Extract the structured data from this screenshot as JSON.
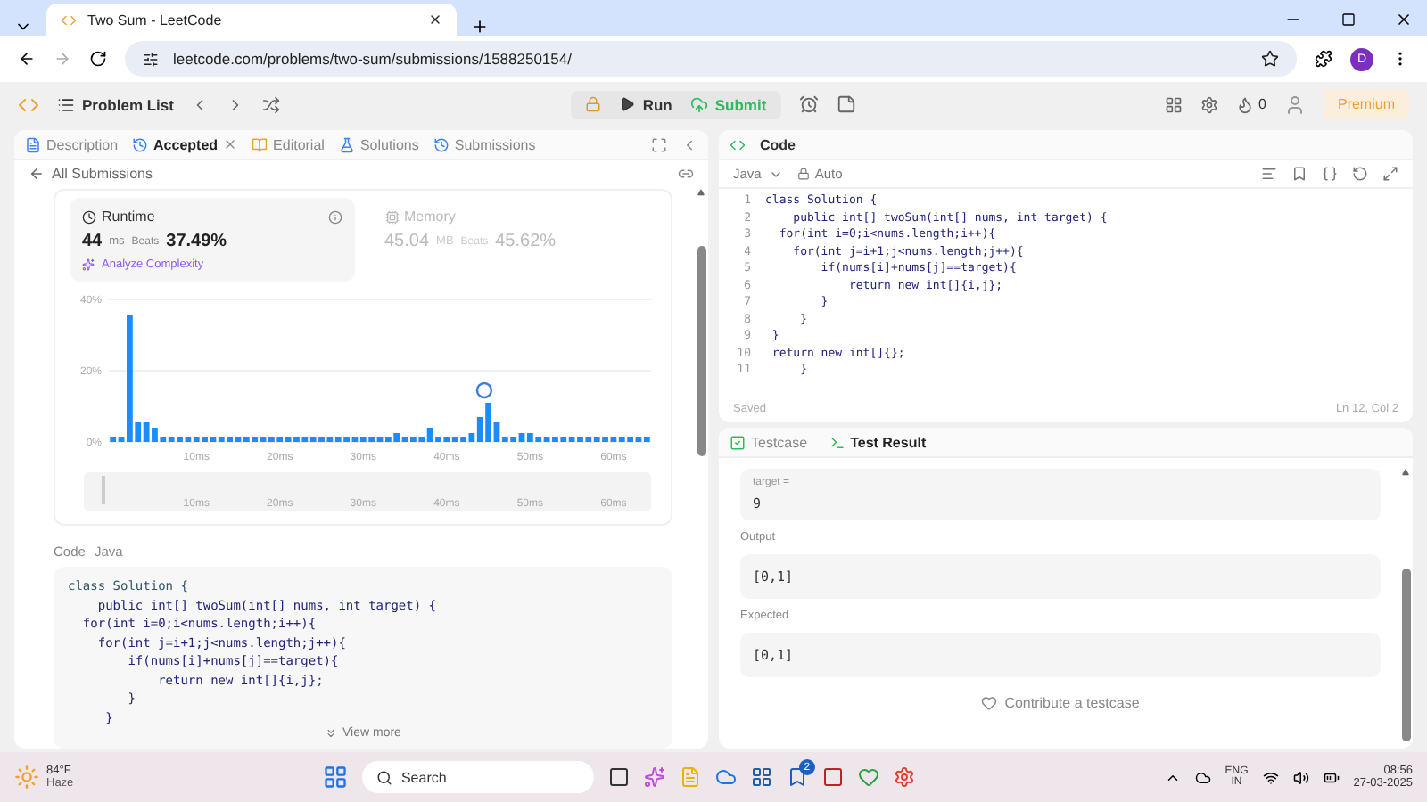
{
  "browser": {
    "tabs": [
      {
        "title": "Two Sum - LeetCode",
        "selected": true
      }
    ],
    "url": "leetcode.com/problems/two-sum/submissions/1588250154/",
    "profile": "D"
  },
  "nav": {
    "problem_list": "Problem List",
    "run": "Run",
    "submit": "Submit",
    "streak": "0",
    "premium": "Premium"
  },
  "left": {
    "tabs": [
      {
        "label": "Description",
        "selected": false
      },
      {
        "label": "Accepted",
        "selected": true
      },
      {
        "label": "Editorial",
        "selected": false
      },
      {
        "label": "Solutions",
        "selected": false
      },
      {
        "label": "Submissions",
        "selected": false
      }
    ],
    "back": "All Submissions",
    "stats": [
      {
        "title": "Runtime",
        "value": "44",
        "unit": "ms",
        "beats_label": "Beats",
        "beats": "37.49%",
        "analyze": "Analyze Complexity",
        "selected": true
      },
      {
        "title": "Memory",
        "value": "45.04",
        "unit": "MB",
        "beats_label": "Beats",
        "beats": "45.62%",
        "selected": false
      }
    ],
    "chart_data": {
      "type": "bar",
      "x": [
        0,
        1,
        2,
        3,
        4,
        5,
        6,
        7,
        8,
        9,
        10,
        11,
        12,
        13,
        14,
        15,
        16,
        17,
        18,
        19,
        20,
        21,
        22,
        23,
        24,
        25,
        26,
        27,
        28,
        29,
        30,
        31,
        32,
        33,
        34,
        35,
        36,
        37,
        38,
        39,
        40,
        41,
        42,
        43,
        44,
        45,
        46,
        47,
        48,
        49,
        50,
        51,
        52,
        53,
        54,
        55,
        56,
        57,
        58,
        59,
        60,
        61,
        62,
        63,
        64
      ],
      "values": [
        1.5,
        1.5,
        35.5,
        5.5,
        5.5,
        4,
        1.5,
        1.5,
        1.5,
        1.5,
        1.5,
        1.5,
        1.5,
        1.5,
        1.5,
        1.5,
        1.5,
        1.5,
        1.5,
        1.5,
        1.5,
        1.5,
        1.5,
        1.5,
        1.5,
        1.5,
        1.5,
        1.5,
        1.5,
        1.5,
        1.5,
        1.5,
        1.5,
        1.5,
        2.5,
        1.5,
        1.5,
        1.5,
        4,
        1.5,
        1.5,
        1.5,
        1.5,
        2.5,
        7,
        11,
        5.5,
        1.5,
        1.5,
        2.5,
        2.5,
        1.5,
        1.5,
        1.5,
        1.5,
        1.5,
        1.5,
        1.5,
        1.5,
        1.5,
        1.5,
        1.5,
        1.5,
        1.5,
        1.5
      ],
      "xlim": [
        -0.5,
        64.5
      ],
      "ylim": [
        0,
        40
      ],
      "xticks": [
        {
          "value": 10,
          "label": "10ms"
        },
        {
          "value": 20,
          "label": "20ms"
        },
        {
          "value": 30,
          "label": "30ms"
        },
        {
          "value": 40,
          "label": "40ms"
        },
        {
          "value": 50,
          "label": "50ms"
        },
        {
          "value": 60,
          "label": "60ms"
        }
      ],
      "yticks": [
        {
          "value": 0,
          "label": "0%"
        },
        {
          "value": 20,
          "label": "20%"
        },
        {
          "value": 40,
          "label": "40%"
        }
      ]
    },
    "range": {
      "labels": [
        "10ms",
        "20ms",
        "30ms",
        "40ms",
        "50ms",
        "60ms"
      ],
      "level": 1
    },
    "code": {
      "label": "Code",
      "language": "Java",
      "more": "View more",
      "lines": [
        "class Solution {",
        "    public int[] twoSum(int[] nums, int target) {",
        "  for(int i=0;i<nums.length;i++){",
        "    for(int j=i+1;j<nums.length;j++){",
        "        if(nums[i]+nums[j]==target){",
        "            return new int[]{i,j};",
        "        }",
        "     }"
      ]
    }
  },
  "editor": {
    "title": "Code",
    "language": "Java",
    "mode": "Auto",
    "status": "Saved",
    "cursor": "Ln 12, Col 2",
    "lines": [
      {
        "number": "1",
        "text": "class Solution {"
      },
      {
        "number": "2",
        "text": "    public int[] twoSum(int[] nums, int target) {"
      },
      {
        "number": "3",
        "text": "  for(int i=0;i<nums.length;i++){"
      },
      {
        "number": "4",
        "text": "    for(int j=i+1;j<nums.length;j++){"
      },
      {
        "number": "5",
        "text": "        if(nums[i]+nums[j]==target){"
      },
      {
        "number": "6",
        "text": "            return new int[]{i,j};"
      },
      {
        "number": "7",
        "text": "        }"
      },
      {
        "number": "8",
        "text": "     }"
      },
      {
        "number": "9",
        "text": " }"
      },
      {
        "number": "10",
        "text": " return new int[]{};"
      },
      {
        "number": "11",
        "text": "     }"
      }
    ]
  },
  "result": {
    "tabs": [
      {
        "label": "Testcase",
        "selected": false
      },
      {
        "label": "Test Result",
        "selected": true
      }
    ],
    "inputs": [
      {
        "label": "target =",
        "value": "9"
      }
    ],
    "sections": [
      {
        "label": "Output",
        "value": "[0,1]"
      },
      {
        "label": "Expected",
        "value": "[0,1]"
      }
    ],
    "contribute": "Contribute a testcase"
  },
  "taskbar": {
    "temperature": "84°F",
    "weather": "Haze",
    "search": "Search",
    "badge": "2",
    "language": "ENG",
    "region": "IN",
    "time": "08:56",
    "date": "27-03-2025"
  }
}
